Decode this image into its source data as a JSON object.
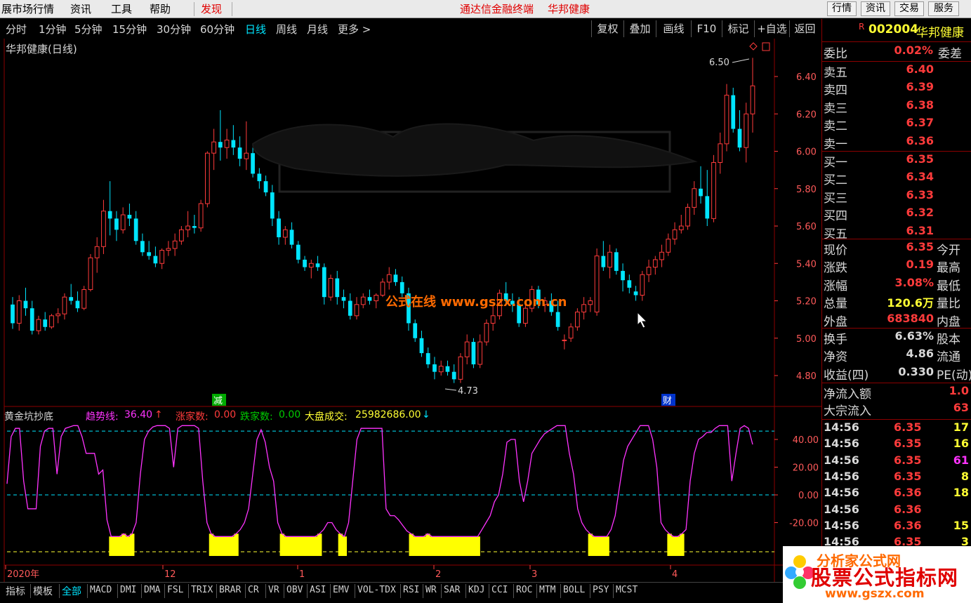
{
  "menu": {
    "items": [
      "展市场行情",
      "资讯",
      "工具",
      "帮助"
    ],
    "highlight": "发现",
    "center_title": "通达信金融终端",
    "center_stock": "华邦健康",
    "right_buttons": [
      "行情",
      "资讯",
      "交易",
      "服务"
    ]
  },
  "periods": {
    "items": [
      "分时",
      "1分钟",
      "5分钟",
      "15分钟",
      "30分钟",
      "60分钟",
      "日线",
      "周线",
      "月线",
      "更多 >"
    ],
    "active": "日线",
    "tools": [
      "复权",
      "叠加",
      "画线",
      "F10",
      "标记",
      "+自选",
      "返回"
    ]
  },
  "chart": {
    "title": "华邦健康(日线)",
    "price_axis": [
      "6.40",
      "6.20",
      "6.00",
      "5.80",
      "5.60",
      "5.40",
      "5.20",
      "5.00",
      "4.80"
    ],
    "high_label": "6.50",
    "low_label": "4.73",
    "watermark": "公式在线  www.gszx.com.cn",
    "badge_jian": "减",
    "badge_cai": "财",
    "colors": {
      "up": "#ff3b3b",
      "down": "#00e5ff",
      "bg": "#000000"
    }
  },
  "chart_data": {
    "type": "candlestick",
    "ylim": [
      4.7,
      6.55
    ],
    "ohlc": [
      [
        5.18,
        5.22,
        5.05,
        5.08
      ],
      [
        5.08,
        5.23,
        5.04,
        5.2
      ],
      [
        5.2,
        5.27,
        5.12,
        5.16
      ],
      [
        5.16,
        5.2,
        5.02,
        5.04
      ],
      [
        5.04,
        5.12,
        5.02,
        5.1
      ],
      [
        5.1,
        5.14,
        5.04,
        5.06
      ],
      [
        5.06,
        5.13,
        5.05,
        5.12
      ],
      [
        5.12,
        5.16,
        5.08,
        5.13
      ],
      [
        5.13,
        5.24,
        5.1,
        5.22
      ],
      [
        5.22,
        5.29,
        5.18,
        5.2
      ],
      [
        5.2,
        5.25,
        5.14,
        5.16
      ],
      [
        5.16,
        5.28,
        5.15,
        5.26
      ],
      [
        5.26,
        5.45,
        5.25,
        5.43
      ],
      [
        5.43,
        5.54,
        5.35,
        5.49
      ],
      [
        5.49,
        5.74,
        5.45,
        5.68
      ],
      [
        5.68,
        5.84,
        5.55,
        5.64
      ],
      [
        5.64,
        5.68,
        5.52,
        5.58
      ],
      [
        5.58,
        5.7,
        5.56,
        5.66
      ],
      [
        5.66,
        5.72,
        5.6,
        5.64
      ],
      [
        5.64,
        5.68,
        5.5,
        5.52
      ],
      [
        5.52,
        5.56,
        5.44,
        5.46
      ],
      [
        5.46,
        5.52,
        5.42,
        5.44
      ],
      [
        5.44,
        5.49,
        5.38,
        5.4
      ],
      [
        5.4,
        5.48,
        5.37,
        5.47
      ],
      [
        5.47,
        5.52,
        5.44,
        5.48
      ],
      [
        5.48,
        5.56,
        5.44,
        5.52
      ],
      [
        5.52,
        5.6,
        5.5,
        5.58
      ],
      [
        5.58,
        5.68,
        5.54,
        5.6
      ],
      [
        5.6,
        5.66,
        5.56,
        5.59
      ],
      [
        5.59,
        5.74,
        5.57,
        5.72
      ],
      [
        5.72,
        6.0,
        5.7,
        5.99
      ],
      [
        5.99,
        6.12,
        5.9,
        6.05
      ],
      [
        6.05,
        6.22,
        5.95,
        6.02
      ],
      [
        6.02,
        6.12,
        5.96,
        6.06
      ],
      [
        6.06,
        6.14,
        5.98,
        6.02
      ],
      [
        6.02,
        6.08,
        5.92,
        5.96
      ],
      [
        5.96,
        6.16,
        5.9,
        5.99
      ],
      [
        5.99,
        6.02,
        5.86,
        5.88
      ],
      [
        5.88,
        5.91,
        5.8,
        5.84
      ],
      [
        5.84,
        5.87,
        5.76,
        5.78
      ],
      [
        5.78,
        5.82,
        5.6,
        5.64
      ],
      [
        5.64,
        5.68,
        5.5,
        5.54
      ],
      [
        5.54,
        5.6,
        5.5,
        5.58
      ],
      [
        5.58,
        5.62,
        5.48,
        5.5
      ],
      [
        5.5,
        5.52,
        5.4,
        5.42
      ],
      [
        5.42,
        5.44,
        5.36,
        5.38
      ],
      [
        5.38,
        5.42,
        5.32,
        5.4
      ],
      [
        5.4,
        5.44,
        5.36,
        5.38
      ],
      [
        5.38,
        5.4,
        5.18,
        5.22
      ],
      [
        5.22,
        5.34,
        5.2,
        5.32
      ],
      [
        5.32,
        5.36,
        5.18,
        5.22
      ],
      [
        5.22,
        5.26,
        5.16,
        5.2
      ],
      [
        5.2,
        5.24,
        5.1,
        5.12
      ],
      [
        5.12,
        5.22,
        5.1,
        5.18
      ],
      [
        5.18,
        5.24,
        5.16,
        5.22
      ],
      [
        5.22,
        5.26,
        5.18,
        5.2
      ],
      [
        5.2,
        5.24,
        5.16,
        5.23
      ],
      [
        5.23,
        5.32,
        5.22,
        5.3
      ],
      [
        5.3,
        5.38,
        5.26,
        5.34
      ],
      [
        5.34,
        5.37,
        5.28,
        5.3
      ],
      [
        5.3,
        5.33,
        5.22,
        5.24
      ],
      [
        5.24,
        5.27,
        5.04,
        5.08
      ],
      [
        5.08,
        5.1,
        4.98,
        5.0
      ],
      [
        5.0,
        5.04,
        4.9,
        4.92
      ],
      [
        4.92,
        4.95,
        4.84,
        4.86
      ],
      [
        4.86,
        4.9,
        4.78,
        4.82
      ],
      [
        4.82,
        4.88,
        4.8,
        4.85
      ],
      [
        4.85,
        4.88,
        4.8,
        4.82
      ],
      [
        4.82,
        4.86,
        4.76,
        4.78
      ],
      [
        4.78,
        4.92,
        4.76,
        4.9
      ],
      [
        4.9,
        5.02,
        4.86,
        4.98
      ],
      [
        4.98,
        5.0,
        4.84,
        4.86
      ],
      [
        4.86,
        5.02,
        4.84,
        4.98
      ],
      [
        4.98,
        5.1,
        4.96,
        5.08
      ],
      [
        5.08,
        5.18,
        5.04,
        5.12
      ],
      [
        5.12,
        5.26,
        5.1,
        5.24
      ],
      [
        5.24,
        5.3,
        5.18,
        5.2
      ],
      [
        5.2,
        5.24,
        5.14,
        5.18
      ],
      [
        5.18,
        5.22,
        5.06,
        5.08
      ],
      [
        5.08,
        5.2,
        5.06,
        5.16
      ],
      [
        5.16,
        5.28,
        5.14,
        5.26
      ],
      [
        5.26,
        5.28,
        5.16,
        5.18
      ],
      [
        5.18,
        5.22,
        5.14,
        5.2
      ],
      [
        5.2,
        5.24,
        5.12,
        5.14
      ],
      [
        5.14,
        5.2,
        5.04,
        5.06
      ],
      [
        4.99,
        5.02,
        4.94,
        4.99
      ],
      [
        5.0,
        5.08,
        4.98,
        5.06
      ],
      [
        5.06,
        5.16,
        5.04,
        5.14
      ],
      [
        5.14,
        5.22,
        5.1,
        5.18
      ],
      [
        5.18,
        5.22,
        5.14,
        5.2
      ],
      [
        5.14,
        5.48,
        5.12,
        5.44
      ],
      [
        5.44,
        5.52,
        5.36,
        5.38
      ],
      [
        5.38,
        5.5,
        5.32,
        5.46
      ],
      [
        5.46,
        5.48,
        5.34,
        5.36
      ],
      [
        5.36,
        5.4,
        5.25,
        5.31
      ],
      [
        5.31,
        5.34,
        5.24,
        5.27
      ],
      [
        5.25,
        5.28,
        5.2,
        5.23
      ],
      [
        5.23,
        5.36,
        5.2,
        5.34
      ],
      [
        5.34,
        5.42,
        5.3,
        5.38
      ],
      [
        5.38,
        5.44,
        5.34,
        5.42
      ],
      [
        5.42,
        5.5,
        5.38,
        5.46
      ],
      [
        5.46,
        5.56,
        5.44,
        5.53
      ],
      [
        5.53,
        5.62,
        5.5,
        5.58
      ],
      [
        5.58,
        5.66,
        5.56,
        5.6
      ],
      [
        5.6,
        5.72,
        5.58,
        5.7
      ],
      [
        5.7,
        5.84,
        5.66,
        5.8
      ],
      [
        5.8,
        5.92,
        5.72,
        5.76
      ],
      [
        5.76,
        5.9,
        5.6,
        5.64
      ],
      [
        5.64,
        5.98,
        5.62,
        5.94
      ],
      [
        5.94,
        6.1,
        5.88,
        6.04
      ],
      [
        6.04,
        6.36,
        6.0,
        6.3
      ],
      [
        6.3,
        6.34,
        6.1,
        6.12
      ],
      [
        6.12,
        6.22,
        6.0,
        6.02
      ],
      [
        6.02,
        6.26,
        5.94,
        6.2
      ],
      [
        6.2,
        6.5,
        6.1,
        6.35
      ]
    ]
  },
  "indicator": {
    "name": "黄金坑抄底",
    "trend_label": "趋势线:",
    "trend_value": "36.40",
    "up_label": "涨家数:",
    "up_value": "0.00",
    "down_label": "跌家数:",
    "down_value": "0.00",
    "vol_label": "大盘成交:",
    "vol_value": "25982686.00",
    "axis": [
      "40.00",
      "20.00",
      "0.00",
      "-20.00"
    ],
    "trend_series": [
      8,
      42,
      48,
      48,
      10,
      -10,
      -10,
      -10,
      35,
      46,
      48,
      48,
      15,
      42,
      48,
      49,
      50,
      50,
      42,
      30,
      30,
      30,
      15,
      18,
      -18,
      -30,
      -30,
      -30,
      -28,
      -30,
      -28,
      -20,
      15,
      40,
      46,
      49,
      50,
      50,
      50,
      48,
      20,
      48,
      50,
      50,
      50,
      50,
      48,
      10,
      -20,
      -28,
      -30,
      -30,
      -30,
      -30,
      -30,
      -28,
      -25,
      -20,
      -10,
      15,
      40,
      47,
      38,
      20,
      10,
      -20,
      -28,
      -30,
      -30,
      -30,
      -30,
      -30,
      -30,
      -30,
      -30,
      -28,
      -25,
      -20,
      -20,
      -25,
      -28,
      -30,
      -20,
      10,
      40,
      48,
      48,
      48,
      48,
      48,
      48,
      -10,
      -15,
      -15,
      -18,
      -22,
      -26,
      -28,
      -30,
      -30,
      -30,
      -28,
      -30,
      -30,
      -30,
      -30,
      -30,
      -30,
      -30,
      -30,
      -30,
      -30,
      -30,
      -30,
      -25,
      -20,
      -15,
      -5,
      0,
      15,
      38,
      40,
      40,
      10,
      -5,
      10,
      30,
      35,
      40,
      44,
      46,
      48,
      50,
      50,
      50,
      30,
      15,
      -10,
      -20,
      -25,
      -28,
      -30,
      -30,
      -30,
      -30,
      -25,
      -15,
      5,
      25,
      35,
      40,
      45,
      50,
      50,
      50,
      40,
      20,
      -20,
      -25,
      -28,
      -30,
      -30,
      -28,
      -25,
      10,
      30,
      40,
      42,
      45,
      45,
      48,
      50,
      50,
      50,
      10,
      30,
      48,
      50,
      48,
      36.4
    ],
    "colors": {
      "line": "#ff33ff",
      "fill": "#ffff00",
      "ref_top": "#00e5ff",
      "ref_mid": "#00e5ff",
      "ref_bottom": "#ffff33"
    }
  },
  "time_axis": [
    "2020年",
    "12",
    "1",
    "2",
    "3",
    "4"
  ],
  "bottom_tabs": [
    "指标",
    "模板",
    "全部",
    "MACD",
    "DMI",
    "DMA",
    "FSL",
    "TRIX",
    "BRAR",
    "CR",
    "VR",
    "OBV",
    "ASI",
    "EMV",
    "VOL-TDX",
    "RSI",
    "WR",
    "SAR",
    "KDJ",
    "CCI",
    "ROC",
    "MTM",
    "BOLL",
    "PSY",
    "MCST"
  ],
  "quote": {
    "flag": "R",
    "code": "002004",
    "name": "华邦健康",
    "weibi_label": "委比",
    "weibi": "0.02%",
    "weicha_label": "委差",
    "sells": [
      {
        "label": "卖五",
        "price": "6.40"
      },
      {
        "label": "卖四",
        "price": "6.39"
      },
      {
        "label": "卖三",
        "price": "6.38"
      },
      {
        "label": "卖二",
        "price": "6.37"
      },
      {
        "label": "卖一",
        "price": "6.36"
      }
    ],
    "buys": [
      {
        "label": "买一",
        "price": "6.35"
      },
      {
        "label": "买二",
        "price": "6.34"
      },
      {
        "label": "买三",
        "price": "6.33"
      },
      {
        "label": "买四",
        "price": "6.32"
      },
      {
        "label": "买五",
        "price": "6.31"
      }
    ],
    "stats": [
      {
        "label": "现价",
        "value": "6.35",
        "label2": "今开",
        "color": "#ff3b3b"
      },
      {
        "label": "涨跌",
        "value": "0.19",
        "label2": "最高",
        "color": "#ff3b3b"
      },
      {
        "label": "涨幅",
        "value": "3.08%",
        "label2": "最低",
        "color": "#ff3b3b"
      },
      {
        "label": "总量",
        "value": "120.6万",
        "label2": "量比",
        "color": "#ffff33"
      },
      {
        "label": "外盘",
        "value": "683840",
        "label2": "内盘",
        "color": "#ff3b3b"
      }
    ],
    "stats2": [
      {
        "label": "换手",
        "value": "6.63%",
        "label2": "股本",
        "color": "#d8d8d8"
      },
      {
        "label": "净资",
        "value": "4.86",
        "label2": "流通",
        "color": "#d8d8d8"
      },
      {
        "label": "收益(四)",
        "value": "0.330",
        "label2": "PE(动)",
        "color": "#d8d8d8"
      }
    ],
    "flow": [
      {
        "label": "净流入额",
        "value": "1.0"
      },
      {
        "label": "大宗流入",
        "value": "63"
      }
    ],
    "ticks": [
      {
        "time": "14:56",
        "price": "6.35",
        "vol": "17",
        "vcolor": "#ffff33"
      },
      {
        "time": "14:56",
        "price": "6.35",
        "vol": "16",
        "vcolor": "#ffff33"
      },
      {
        "time": "14:56",
        "price": "6.35",
        "vol": "61",
        "vcolor": "#ff33ff"
      },
      {
        "time": "14:56",
        "price": "6.35",
        "vol": "8",
        "vcolor": "#ffff33"
      },
      {
        "time": "14:56",
        "price": "6.36",
        "vol": "18",
        "vcolor": "#ffff33"
      },
      {
        "time": "14:56",
        "price": "6.36",
        "vol": "",
        "vcolor": "#ffff33"
      },
      {
        "time": "14:56",
        "price": "6.36",
        "vol": "15",
        "vcolor": "#ffff33"
      },
      {
        "time": "14:56",
        "price": "6.35",
        "vol": "3",
        "vcolor": "#ffff33"
      }
    ]
  },
  "logo": {
    "top": "分析家公式网",
    "main": "股票公式指标网",
    "url": "www.gszx.com"
  }
}
